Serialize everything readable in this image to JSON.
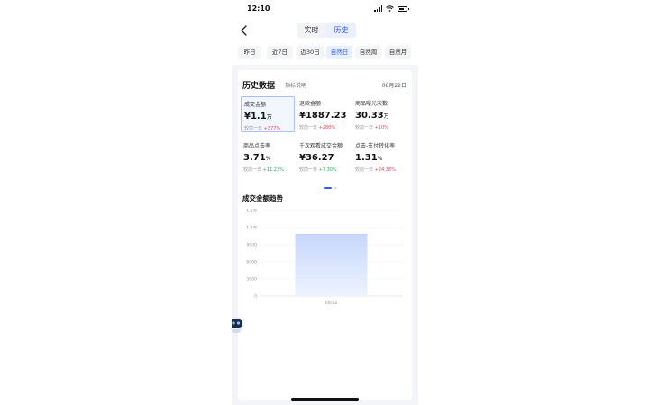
{
  "status_bar": {
    "time": "12:10"
  },
  "nav": {
    "tabs": [
      {
        "label": "实时",
        "active": false
      },
      {
        "label": "历史",
        "active": true
      }
    ]
  },
  "ranges": [
    {
      "label": "昨日",
      "active": false
    },
    {
      "label": "近7日",
      "active": false
    },
    {
      "label": "近30日",
      "active": false
    },
    {
      "label": "自然日",
      "active": true
    },
    {
      "label": "自然周",
      "active": false
    },
    {
      "label": "自然月",
      "active": false
    }
  ],
  "card": {
    "title": "历史数据",
    "help_label": "指标说明",
    "date": "08月22日"
  },
  "metrics": [
    {
      "label": "成交金额",
      "value": "¥1.1",
      "unit": "万",
      "compare_label": "较前一日",
      "change": "+377%",
      "direction": "up",
      "selected": true
    },
    {
      "label": "退款金额",
      "value": "¥1887.23",
      "unit": "",
      "compare_label": "较前一日",
      "change": "+280%",
      "direction": "up",
      "selected": false
    },
    {
      "label": "商品曝光次数",
      "value": "30.33",
      "unit": "万",
      "compare_label": "较前一日",
      "change": "+10%",
      "direction": "up",
      "selected": false
    },
    {
      "label": "商品点击率",
      "value": "3.71",
      "unit": "%",
      "compare_label": "较前一日",
      "change": "+11.23%",
      "direction": "down",
      "selected": false
    },
    {
      "label": "千次观看成交金额",
      "value": "¥36.27",
      "unit": "",
      "compare_label": "较前一日",
      "change": "+7.30%",
      "direction": "down",
      "selected": false
    },
    {
      "label": "点击-支付转化率",
      "value": "1.31",
      "unit": "%",
      "compare_label": "较前一日",
      "change": "+24.38%",
      "direction": "up",
      "selected": false
    }
  ],
  "pager": {
    "count": 2,
    "active": 0
  },
  "trend": {
    "title": "成交金额趋势"
  },
  "chart_data": {
    "type": "area",
    "categories": [
      "08/22"
    ],
    "values": [
      10800
    ],
    "yticks": [
      "1.5万",
      "1.2万",
      "9000",
      "6000",
      "3000",
      "0"
    ],
    "ytick_values": [
      15000,
      12000,
      9000,
      6000,
      3000,
      0
    ],
    "ylim": [
      0,
      15000
    ],
    "xlabel": "",
    "ylabel": "",
    "grid": true,
    "colors": {
      "fill_top": "#c7d7fb",
      "fill_bottom": "#eef3ff",
      "stroke": "#a9c0ff"
    }
  },
  "colors": {
    "accent": "#2c5bf0",
    "up": "#e5484d",
    "down": "#2eaf62"
  }
}
